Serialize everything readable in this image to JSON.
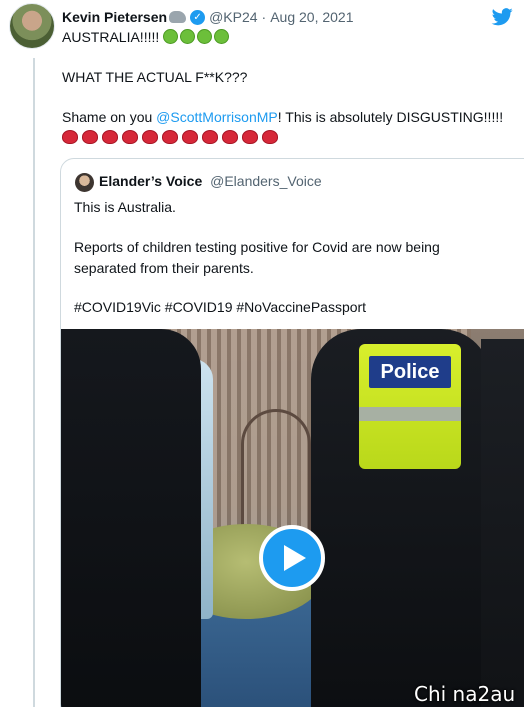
{
  "tweet": {
    "author_name": "Kevin Pietersen",
    "handle": "@KP24",
    "separator": "·",
    "date": "Aug 20, 2021",
    "line1": "AUSTRALIA!!!!!",
    "line2": "WHAT THE ACTUAL F**K???",
    "line3_before": "Shame on you ",
    "line3_mention": "@ScottMorrisonMP",
    "line3_after": "! This is absolutely DISGUSTING!!!!!",
    "sick_emoji_count": 4,
    "angry_emoji_count": 11,
    "icons": [
      "avatar",
      "rhino-icon",
      "verified-badge-icon",
      "twitter-bird-icon",
      "nauseated-face-icon",
      "angry-face-icon"
    ]
  },
  "quote": {
    "author_name": "Elander’s Voice",
    "handle": "@Elanders_Voice",
    "line1": "This is Australia.",
    "line2": "Reports of children testing positive for Covid are now being",
    "line3": "separated from their parents.",
    "hashtags": "#COVID19Vic #COVID19 #NoVaccinePassport"
  },
  "video": {
    "vest_text": "Police",
    "icons": [
      "play-icon"
    ]
  },
  "watermark": "Chi na2au",
  "colors": {
    "link": "#1d9bf0",
    "secondary_text": "#536471",
    "border": "#cfd9de"
  }
}
